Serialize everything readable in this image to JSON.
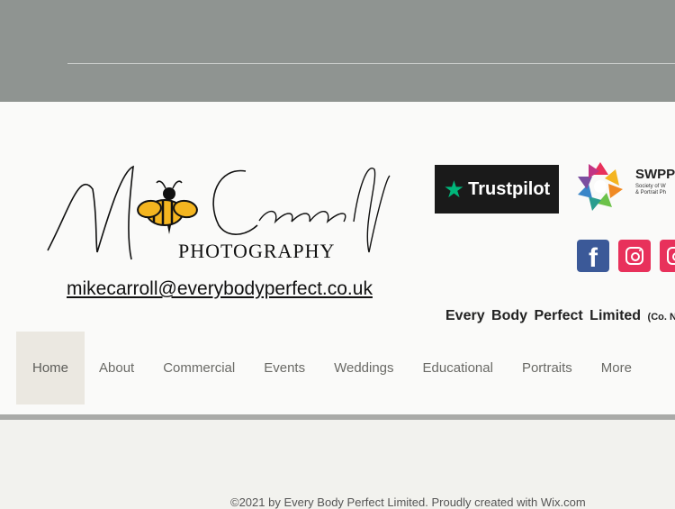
{
  "logo": {
    "script_text": "Mike Carroll",
    "sub_text": "PHOTOGRAPHY"
  },
  "email": "mikecarroll@everybodyperfect.co.uk",
  "trustpilot": {
    "label": "Trustpilot"
  },
  "swpp": {
    "name": "SWPP",
    "sub_line1": "Society of W",
    "sub_line2": "& Portrait Ph"
  },
  "social": [
    "facebook-icon",
    "instagram-icon",
    "instagram-icon"
  ],
  "company": {
    "name": "Every Body Perfect Limited",
    "suffix": "(Co. N"
  },
  "nav": {
    "items": [
      {
        "label": "Home",
        "active": true
      },
      {
        "label": "About"
      },
      {
        "label": "Commercial"
      },
      {
        "label": "Events"
      },
      {
        "label": "Weddings"
      },
      {
        "label": "Educational"
      },
      {
        "label": "Portraits"
      },
      {
        "label": "More"
      }
    ]
  },
  "footer": "©2021 by Every Body Perfect Limited. Proudly created with Wix.com",
  "colors": {
    "top_band": "#8f9491",
    "header_bg": "#fafaf9",
    "active_nav_bg": "#ebe8e1",
    "trustpilot_star": "#00b67a",
    "facebook": "#3b5998",
    "instagram": "#e8315b",
    "bee_yellow": "#f4b520"
  }
}
